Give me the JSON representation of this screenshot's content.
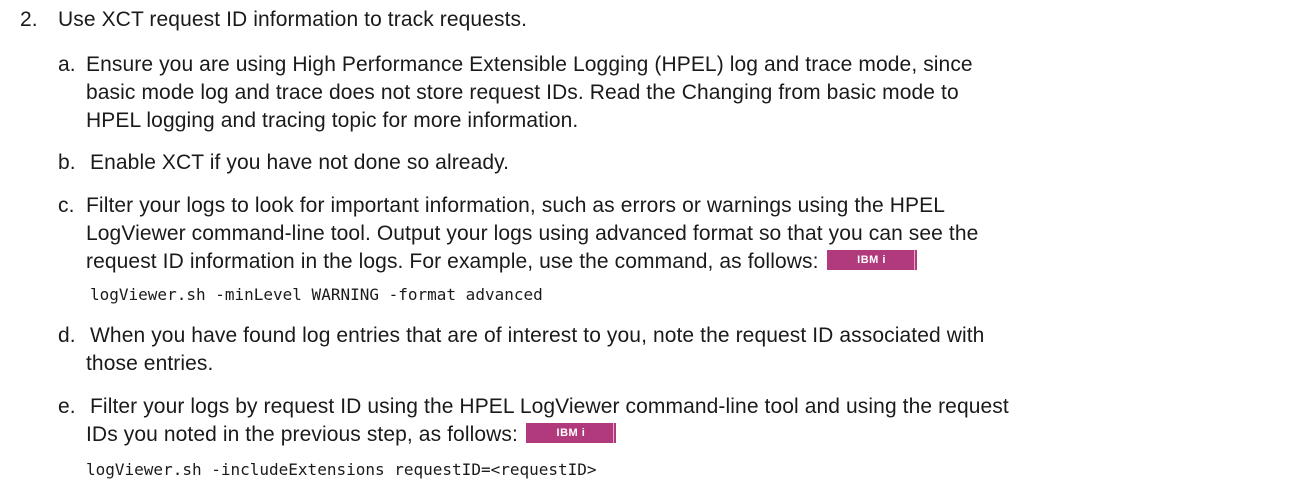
{
  "step": {
    "number": "2.",
    "title": "Use XCT request ID information to track requests."
  },
  "substeps": {
    "a": {
      "letter": "a.",
      "line1": "Ensure you are using High Performance Extensible Logging (HPEL) log and trace mode, since",
      "line2": "basic mode log and trace does not store request IDs. Read the Changing from basic mode to",
      "line3": "HPEL logging and tracing topic for more information."
    },
    "b": {
      "letter": "b.",
      "line1": "Enable XCT if you have not done so already."
    },
    "c": {
      "letter": "c.",
      "line1": "Filter your logs to look for important information, such as errors or warnings using the HPEL",
      "line2": "LogViewer command-line tool. Output your logs using advanced format so that you can see the",
      "line3": "request ID information in the logs. For example, use the command, as follows:",
      "badge": "IBM i",
      "code": "logViewer.sh -minLevel WARNING -format advanced"
    },
    "d": {
      "letter": "d.",
      "line1": "When you have found log entries that are of interest to you, note the request ID associated with",
      "line2": "those entries."
    },
    "e": {
      "letter": "e.",
      "line1": "Filter your logs by request ID using the HPEL LogViewer command-line tool and using the request",
      "line2": "IDs you noted in the previous step, as follows:",
      "badge": "IBM i",
      "code": "logViewer.sh -includeExtensions requestID=<requestID>"
    }
  }
}
